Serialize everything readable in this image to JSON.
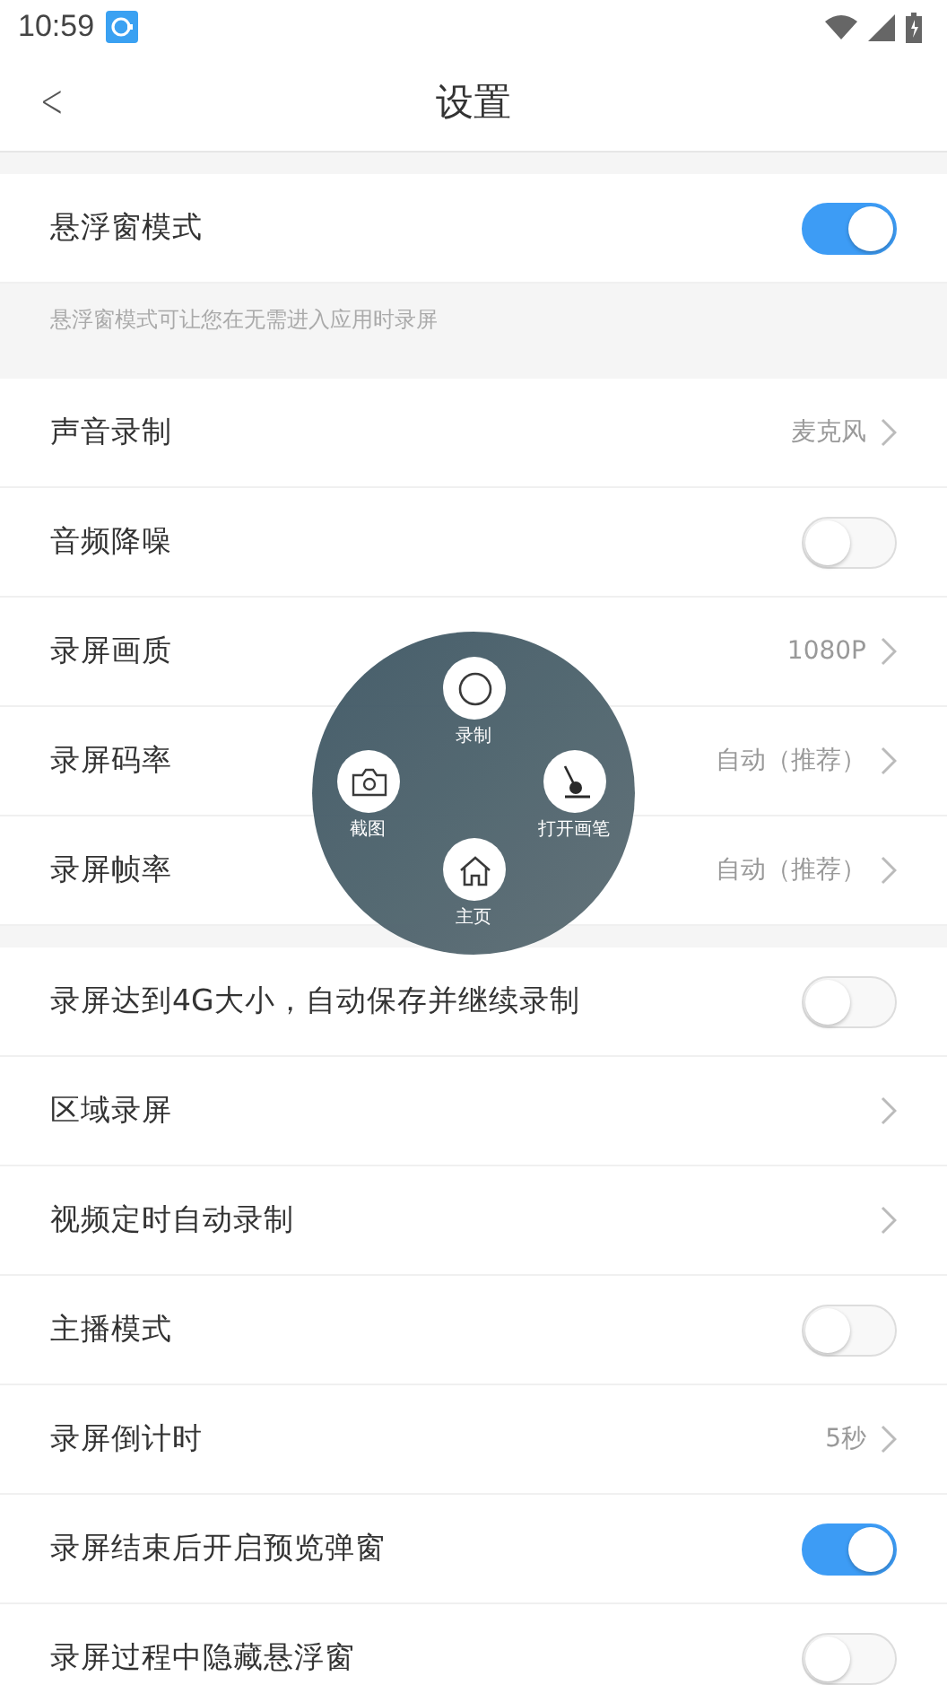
{
  "status_bar": {
    "time": "10:59"
  },
  "header": {
    "back": "<",
    "title": "设置"
  },
  "sections": [
    {
      "rows": [
        {
          "kind": "toggle",
          "label": "悬浮窗模式",
          "on": true
        }
      ],
      "note": "悬浮窗模式可让您在无需进入应用时录屏"
    },
    {
      "rows": [
        {
          "kind": "value",
          "label": "声音录制",
          "value": "麦克风"
        },
        {
          "kind": "toggle",
          "label": "音频降噪",
          "on": false
        },
        {
          "kind": "value",
          "label": "录屏画质",
          "value": "1080P"
        },
        {
          "kind": "value",
          "label": "录屏码率",
          "value": "自动（推荐）"
        },
        {
          "kind": "value",
          "label": "录屏帧率",
          "value": "自动（推荐）"
        }
      ]
    },
    {
      "rows": [
        {
          "kind": "toggle",
          "label": "录屏达到4G大小，自动保存并继续录制",
          "on": false
        },
        {
          "kind": "link",
          "label": "区域录屏"
        },
        {
          "kind": "link",
          "label": "视频定时自动录制"
        },
        {
          "kind": "toggle",
          "label": "主播模式",
          "on": false
        },
        {
          "kind": "value",
          "label": "录屏倒计时",
          "value": "5秒"
        },
        {
          "kind": "toggle",
          "label": "录屏结束后开启预览弹窗",
          "on": true
        },
        {
          "kind": "toggle",
          "label": "录屏过程中隐藏悬浮窗",
          "on": false
        }
      ]
    }
  ],
  "float_menu": [
    {
      "kind": "record",
      "label": "录制"
    },
    {
      "kind": "screenshot",
      "label": "截图"
    },
    {
      "kind": "brush",
      "label": "打开画笔"
    },
    {
      "kind": "home",
      "label": "主页"
    }
  ]
}
